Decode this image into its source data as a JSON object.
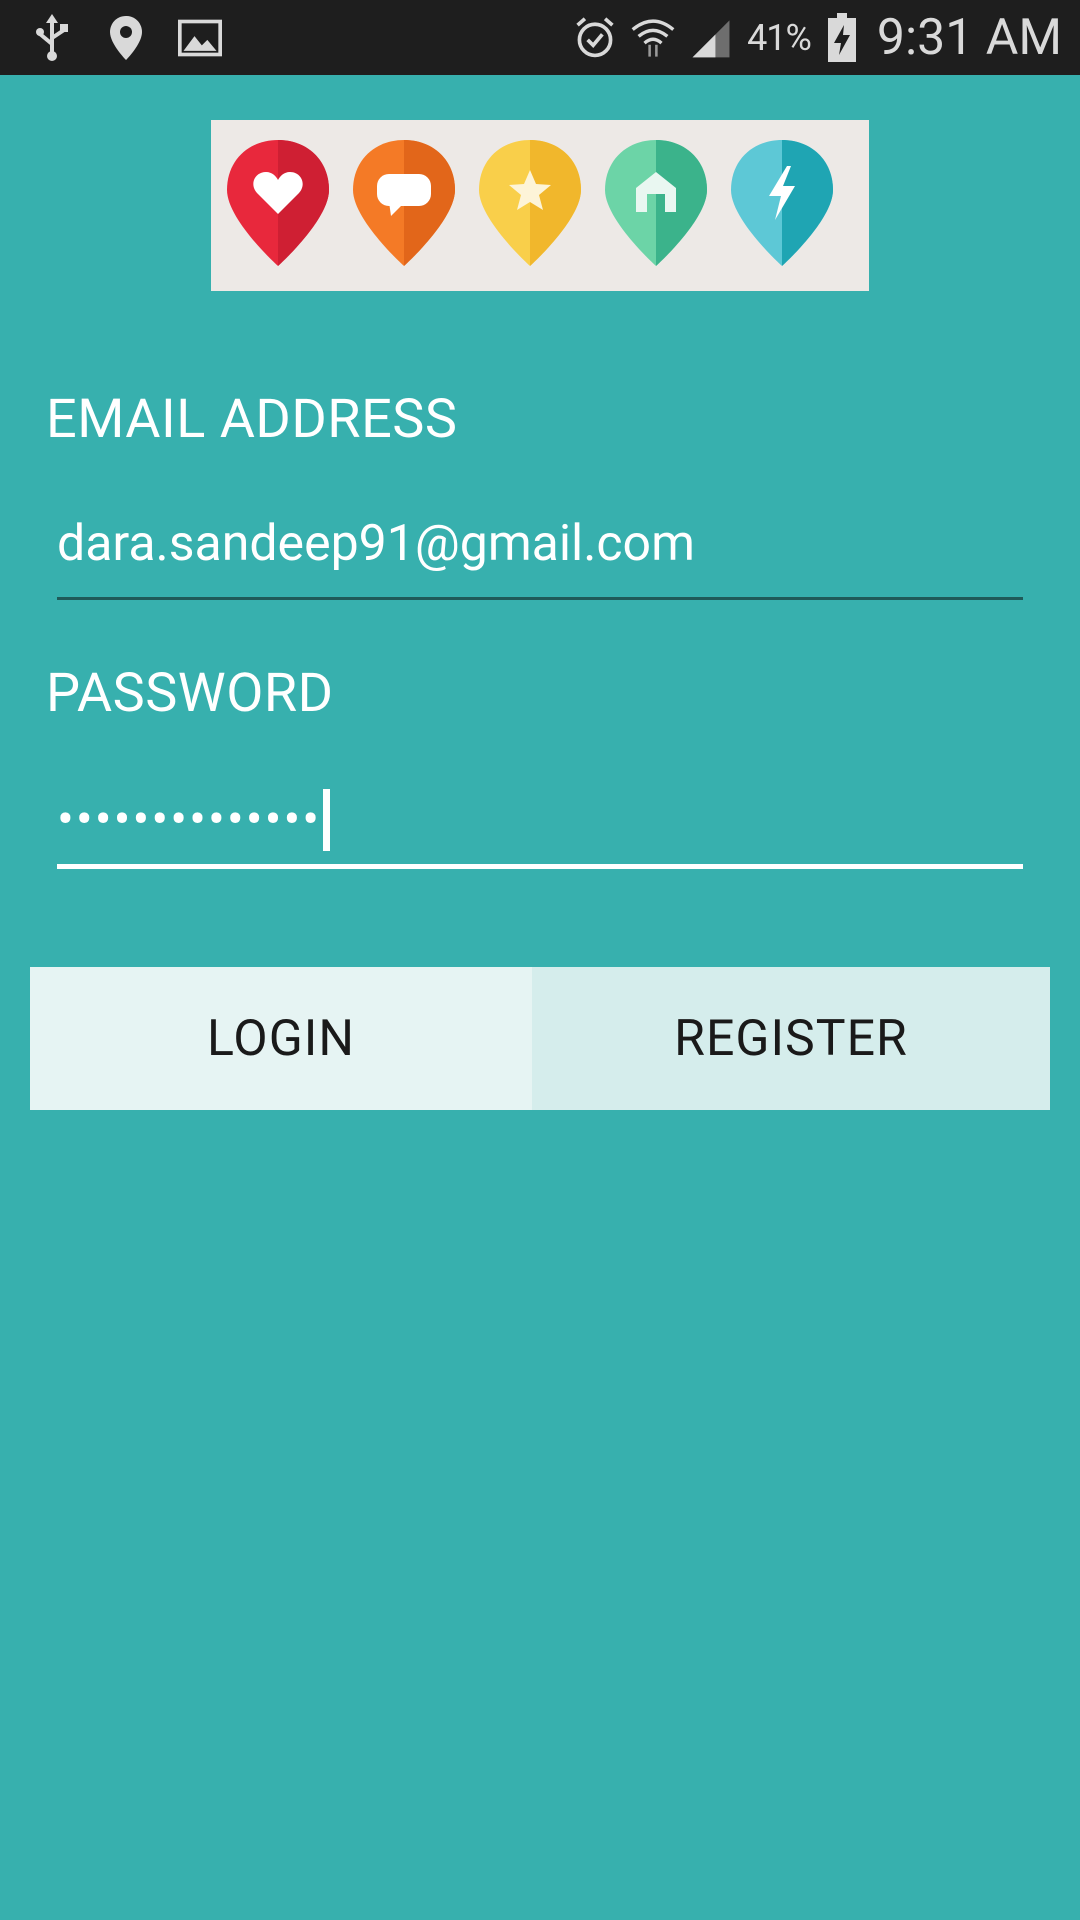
{
  "status_bar": {
    "battery_percent": "41%",
    "time": "9:31 AM",
    "left_icons": [
      "usb-icon",
      "location-pin-icon",
      "image-icon"
    ],
    "right_icons": [
      "alarm-icon",
      "wifi-icon",
      "signal-icon",
      "battery-charging-icon"
    ]
  },
  "logo": {
    "pins": [
      {
        "icon": "heart-icon",
        "color": "#e8283c"
      },
      {
        "icon": "chat-bubble-icon",
        "color": "#f47a26"
      },
      {
        "icon": "star-icon",
        "color": "#f6be34"
      },
      {
        "icon": "home-icon",
        "color": "#52c69a"
      },
      {
        "icon": "lightning-icon",
        "color": "#33b4c4"
      }
    ]
  },
  "form": {
    "email_label": "EMAIL ADDRESS",
    "email_value": "dara.sandeep91@gmail.com",
    "password_label": "PASSWORD",
    "password_value": "••••••••••••••"
  },
  "buttons": {
    "login": "LOGIN",
    "register": "REGISTER"
  },
  "colors": {
    "background": "#37b0ae",
    "status_bar": "#1e1e1e"
  }
}
